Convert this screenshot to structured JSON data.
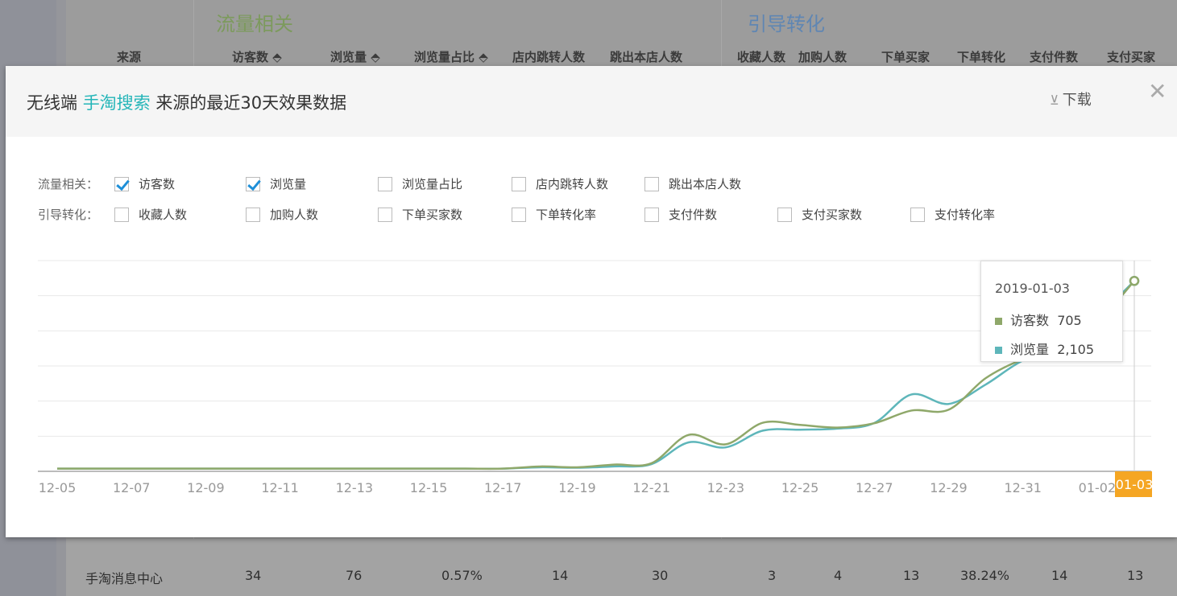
{
  "background_table": {
    "groups": [
      "流量相关",
      "引导转化"
    ],
    "headers": [
      "来源",
      "访客数 ⬘",
      "浏览量 ⬘",
      "浏览量占比 ⬘",
      "店内跳转人数",
      "跳出本店人数",
      "收藏人数",
      "加购人数",
      "下单买家",
      "下单转化",
      "支付件数",
      "支付买家"
    ],
    "row": [
      "手淘消息中心",
      "34",
      "76",
      "0.57%",
      "14",
      "30",
      "3",
      "4",
      "13",
      "38.24%",
      "14",
      "13"
    ]
  },
  "modal": {
    "title_prefix": "无线端",
    "title_source": "手淘搜索",
    "title_suffix": "来源的最近30天效果数据",
    "download_label": "下载",
    "close_glyph": "✕",
    "group_traffic": "流量相关：",
    "group_conversion": "引导转化：",
    "traffic_options": [
      {
        "label": "访客数",
        "checked": true
      },
      {
        "label": "浏览量",
        "checked": true
      },
      {
        "label": "浏览量占比",
        "checked": false
      },
      {
        "label": "店内跳转人数",
        "checked": false
      },
      {
        "label": "跳出本店人数",
        "checked": false
      }
    ],
    "conversion_options": [
      {
        "label": "收藏人数",
        "checked": false
      },
      {
        "label": "加购人数",
        "checked": false
      },
      {
        "label": "下单买家数",
        "checked": false
      },
      {
        "label": "下单转化率",
        "checked": false
      },
      {
        "label": "支付件数",
        "checked": false
      },
      {
        "label": "支付买家数",
        "checked": false
      },
      {
        "label": "支付转化率",
        "checked": false
      }
    ],
    "tooltip": {
      "date": "2019-01-03",
      "rows": [
        {
          "name": "访客数",
          "value": "705"
        },
        {
          "name": "浏览量",
          "value": "2,105"
        }
      ]
    }
  },
  "colors": {
    "visitors": "#8fa86a",
    "pageviews": "#5eb6ba",
    "highlight_label": "#f5a623",
    "accent": "#24b5b8"
  },
  "chart_data": {
    "type": "line",
    "x": [
      "12-05",
      "12-06",
      "12-07",
      "12-08",
      "12-09",
      "12-10",
      "12-11",
      "12-12",
      "12-13",
      "12-14",
      "12-15",
      "12-16",
      "12-17",
      "12-18",
      "12-19",
      "12-20",
      "12-21",
      "12-22",
      "12-23",
      "12-24",
      "12-25",
      "12-26",
      "12-27",
      "12-28",
      "12-29",
      "12-30",
      "12-31",
      "01-01",
      "01-02",
      "01-03"
    ],
    "x_tick_labels": [
      "12-05",
      "12-07",
      "12-09",
      "12-11",
      "12-13",
      "12-15",
      "12-17",
      "12-19",
      "12-21",
      "12-23",
      "12-25",
      "12-27",
      "12-29",
      "12-31",
      "01-02",
      "01-03"
    ],
    "highlighted_x": "01-03",
    "series": [
      {
        "name": "访客数",
        "axis": "left",
        "ylim": [
          0,
          780
        ],
        "values": [
          10,
          10,
          10,
          10,
          10,
          10,
          10,
          10,
          10,
          10,
          10,
          10,
          10,
          18,
          15,
          25,
          30,
          135,
          100,
          180,
          172,
          162,
          178,
          225,
          228,
          345,
          415,
          455,
          550,
          705
        ]
      },
      {
        "name": "浏览量",
        "axis": "right",
        "ylim": [
          0,
          2330
        ],
        "values": [
          30,
          30,
          30,
          30,
          30,
          30,
          30,
          30,
          30,
          30,
          30,
          30,
          30,
          45,
          40,
          55,
          80,
          320,
          265,
          450,
          460,
          472,
          535,
          850,
          745,
          960,
          1225,
          1340,
          1700,
          2105
        ]
      }
    ],
    "grid": true,
    "legend": "none"
  }
}
